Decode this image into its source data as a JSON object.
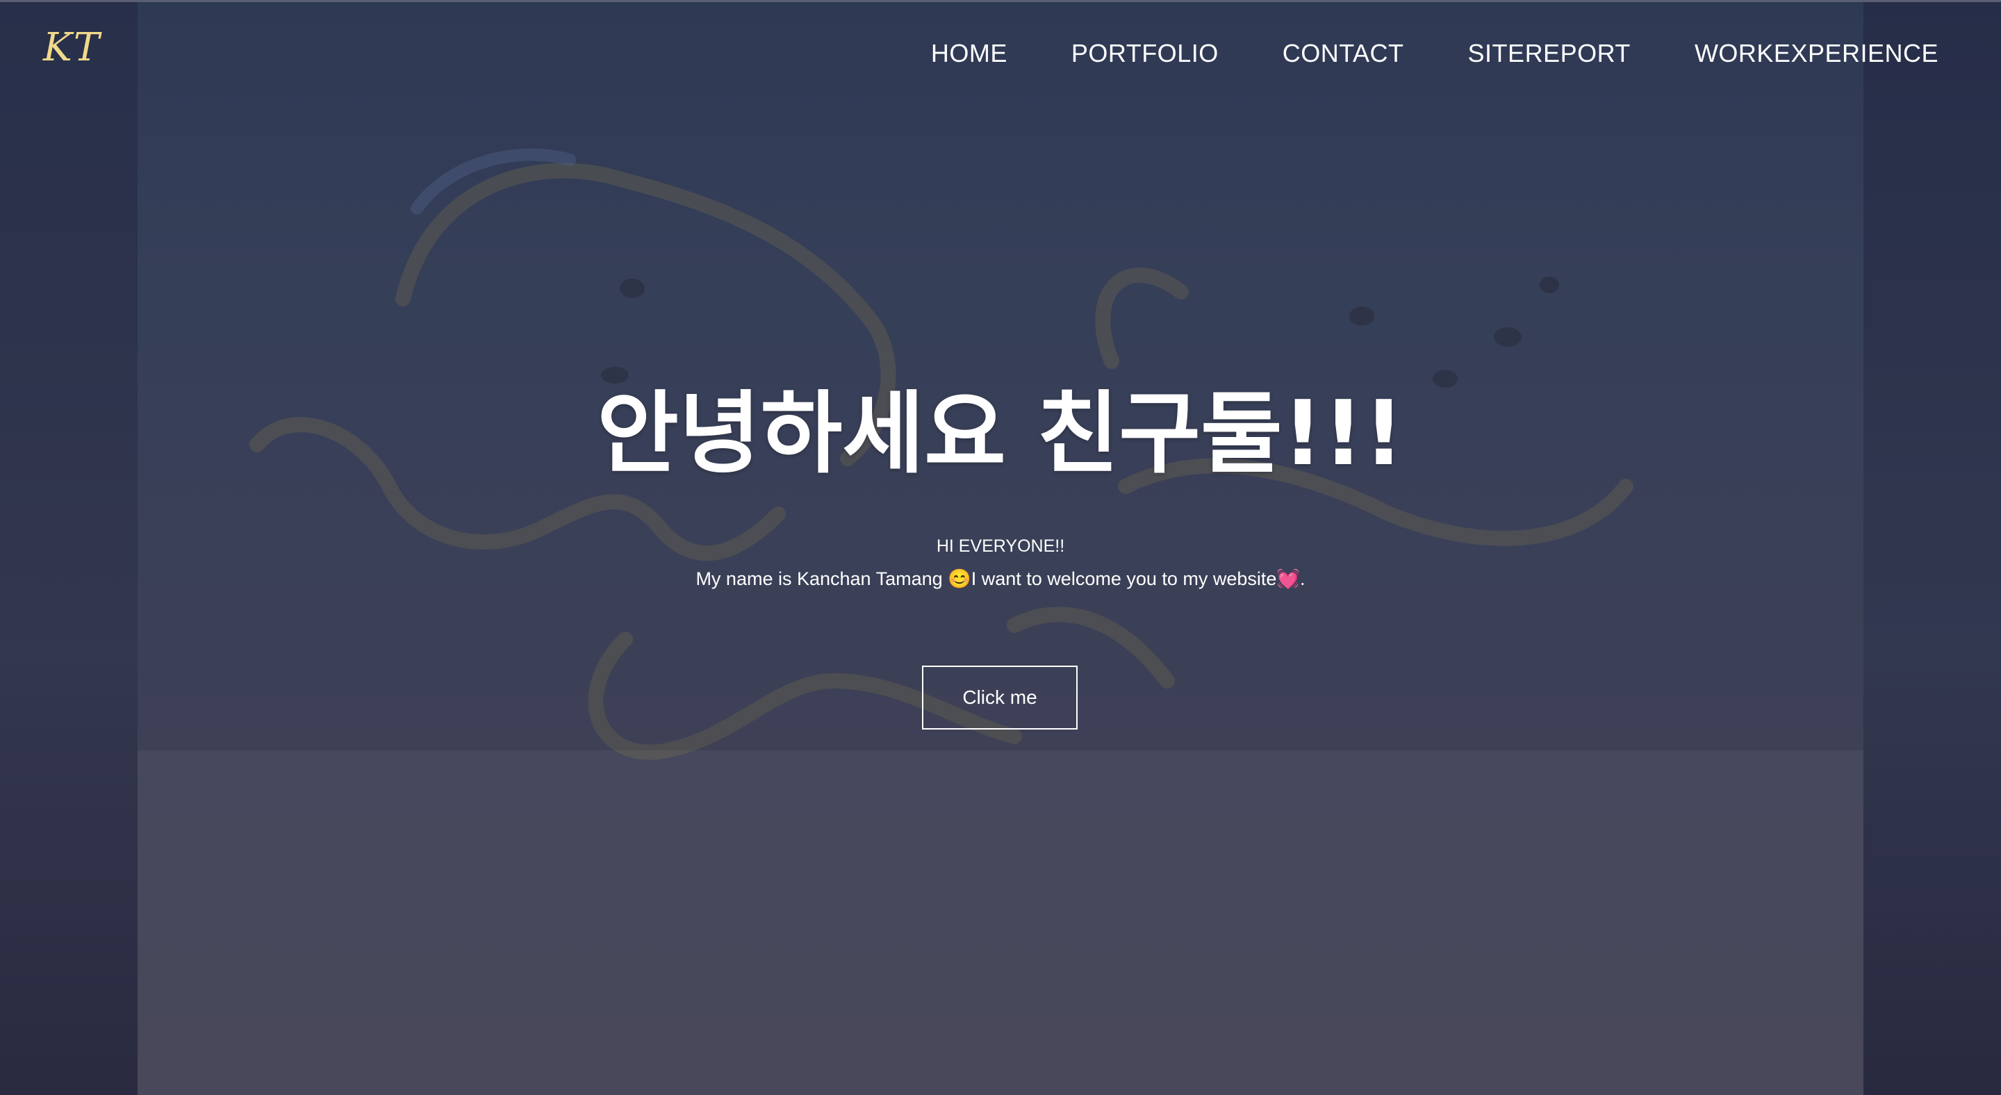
{
  "header": {
    "logo_text": "KT",
    "nav_items": [
      {
        "label": "HOME"
      },
      {
        "label": "PORTFOLIO"
      },
      {
        "label": "CONTACT"
      },
      {
        "label": "SITEREPORT"
      },
      {
        "label": "WORKEXPERIENCE"
      }
    ]
  },
  "hero": {
    "title": "안녕하세요 친구둘!!!",
    "subtitle_line1": "HI EVERYONE!!",
    "subtitle_line2": "My name is Kanchan Tamang 😊I want to welcome you to my website💓.",
    "button_label": "Click me"
  },
  "colors": {
    "logo": "#f0d98a",
    "text": "#ffffff",
    "background": "#3b4058"
  }
}
